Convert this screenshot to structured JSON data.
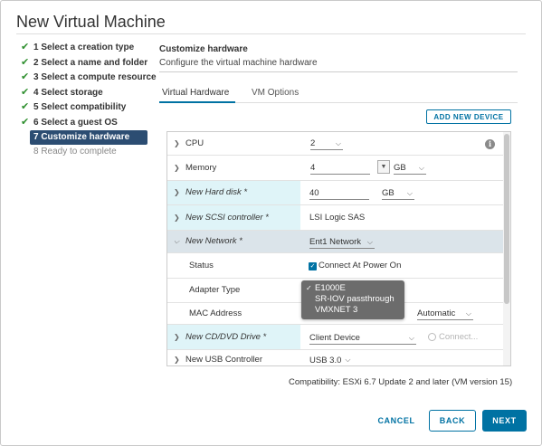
{
  "dialog": {
    "title": "New Virtual Machine"
  },
  "steps": [
    {
      "label": "1 Select a creation type",
      "state": "done"
    },
    {
      "label": "2 Select a name and folder",
      "state": "done"
    },
    {
      "label": "3 Select a compute resource",
      "state": "done"
    },
    {
      "label": "4 Select storage",
      "state": "done"
    },
    {
      "label": "5 Select compatibility",
      "state": "done"
    },
    {
      "label": "6 Select a guest OS",
      "state": "done"
    },
    {
      "label": "7 Customize hardware",
      "state": "active"
    },
    {
      "label": "8 Ready to complete",
      "state": "pending"
    }
  ],
  "panel": {
    "title": "Customize hardware",
    "subtitle": "Configure the virtual machine hardware"
  },
  "tabs": [
    {
      "label": "Virtual Hardware",
      "active": true
    },
    {
      "label": "VM Options",
      "active": false
    }
  ],
  "add_device_label": "ADD NEW DEVICE",
  "hardware": {
    "cpu": {
      "label": "CPU",
      "value": "2"
    },
    "memory": {
      "label": "Memory",
      "value": "4",
      "unit": "GB"
    },
    "hard_disk": {
      "label": "New Hard disk *",
      "value": "40",
      "unit": "GB"
    },
    "scsi": {
      "label": "New SCSI controller *",
      "value": "LSI Logic SAS"
    },
    "network": {
      "label": "New Network *",
      "value": "Ent1 Network"
    },
    "status": {
      "label": "Status",
      "value": "Connect At Power On",
      "checked": true
    },
    "adapter": {
      "label": "Adapter Type"
    },
    "mac": {
      "label": "MAC Address",
      "value": "Automatic"
    },
    "cdrom": {
      "label": "New CD/DVD Drive *",
      "value": "Client Device",
      "connect_label": "Connect..."
    },
    "usb": {
      "label": "New USB Controller",
      "value": "USB 3.0"
    }
  },
  "adapter_options": [
    {
      "label": "E1000E",
      "selected": true
    },
    {
      "label": "SR-IOV passthrough",
      "selected": false
    },
    {
      "label": "VMXNET 3",
      "selected": false
    }
  ],
  "compatibility": "Compatibility: ESXi 6.7 Update 2 and later (VM version 15)",
  "buttons": {
    "cancel": "CANCEL",
    "back": "BACK",
    "next": "NEXT"
  },
  "colors": {
    "accent": "#0072a3",
    "active_step": "#2c4d72",
    "check": "#2f8f2f"
  },
  "icons": {
    "check": "check-icon",
    "chevron_right": "chevron-right-icon",
    "chevron_down": "chevron-down-icon",
    "info": "info-icon"
  }
}
